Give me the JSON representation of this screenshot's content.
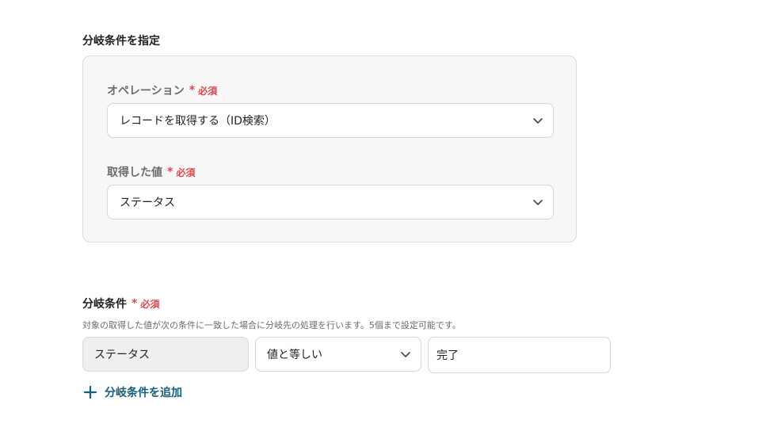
{
  "branch_section": {
    "title": "分岐条件を指定",
    "operation": {
      "label": "オペレーション",
      "required_mark": "*",
      "required_text": "必須",
      "value": "レコードを取得する（ID検索）"
    },
    "acquired_value": {
      "label": "取得した値",
      "required_mark": "*",
      "required_text": "必須",
      "value": "ステータス"
    }
  },
  "conditions": {
    "title": "分岐条件",
    "required_mark": "*",
    "required_text": "必須",
    "description": "対象の取得した値が次の条件に一致した場合に分岐先の処理を行います。5個まで設定可能です。",
    "row": {
      "field": "ステータス",
      "operator": "値と等しい",
      "value": "完了"
    },
    "add_label": "分岐条件を追加"
  },
  "colors": {
    "required": "#e0474c",
    "link": "#155e7a"
  },
  "icons": {
    "dropdown": "chevron-down-icon",
    "add": "plus-icon"
  }
}
